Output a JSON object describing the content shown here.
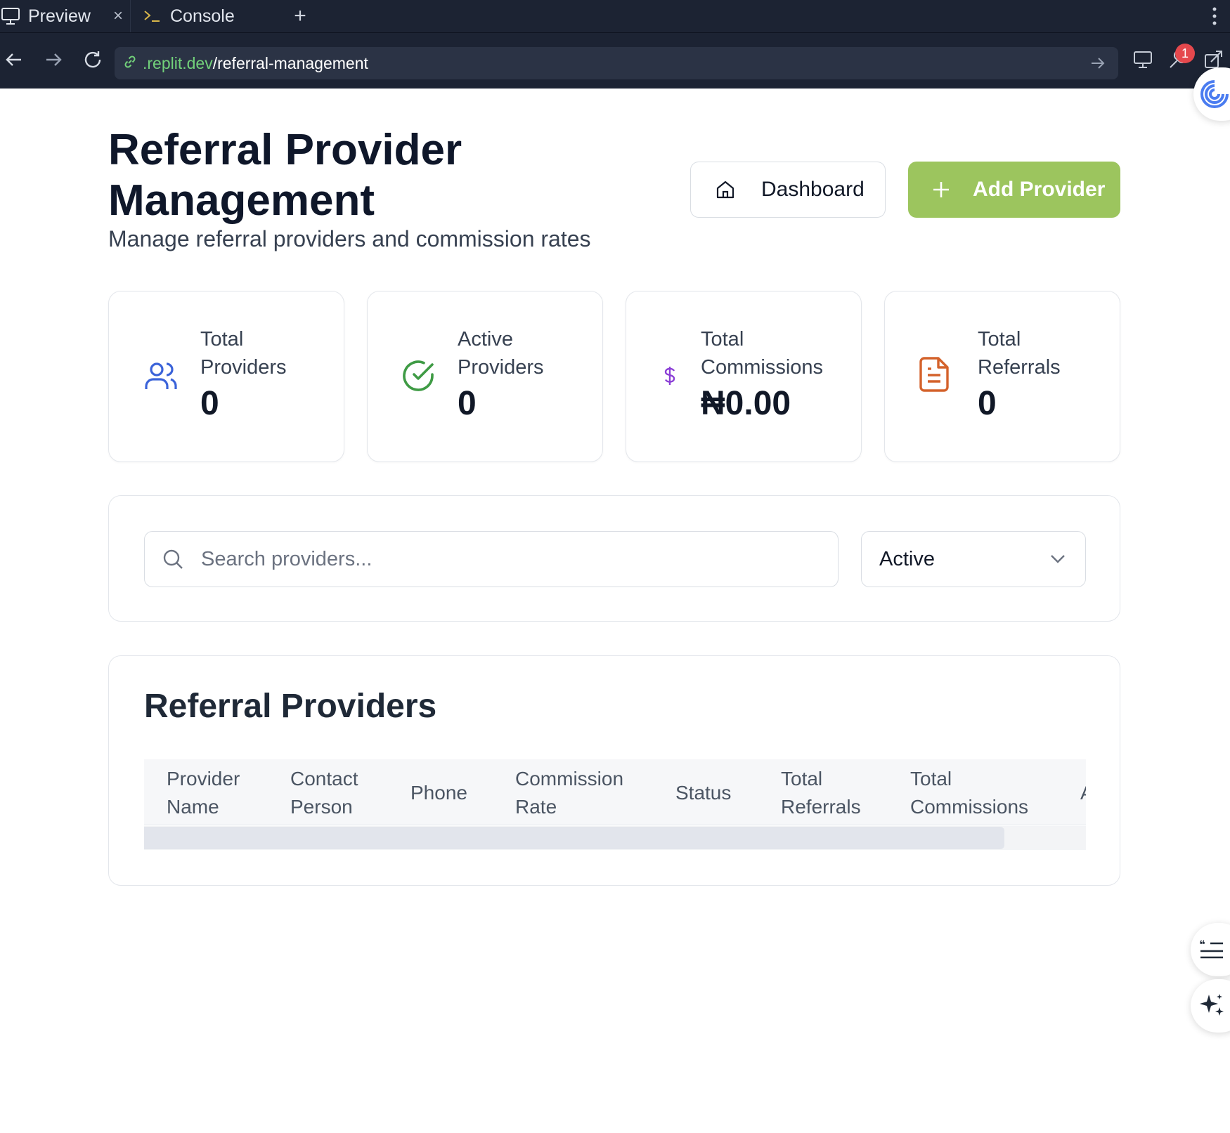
{
  "browser": {
    "tabs": [
      {
        "label": "Preview",
        "icon": "monitor-icon",
        "active": true
      },
      {
        "label": "Console",
        "icon": "terminal-icon",
        "active": false
      }
    ],
    "close_glyph": "×",
    "new_tab_glyph": "+",
    "url_host": ".replit.dev",
    "url_path": "/referral-management",
    "notification_count": "1"
  },
  "header": {
    "title": "Referral Provider Management",
    "subtitle": "Manage referral providers and commission rates",
    "dashboard_label": "Dashboard",
    "add_label": "Add Provider"
  },
  "stats": [
    {
      "label": "Total Providers",
      "value": "0",
      "icon": "users-icon",
      "color": "#3b63d9"
    },
    {
      "label": "Active Providers",
      "value": "0",
      "icon": "check-circle-icon",
      "color": "#3f9b45"
    },
    {
      "label": "Total Commissions",
      "value": "₦0.00",
      "icon": "dollar-icon",
      "color": "#8b3fd6"
    },
    {
      "label": "Total Referrals",
      "value": "0",
      "icon": "file-text-icon",
      "color": "#d4622b"
    }
  ],
  "filters": {
    "search_placeholder": "Search providers...",
    "status_value": "Active"
  },
  "table": {
    "title": "Referral Providers",
    "columns": [
      "Provider Name",
      "Contact Person",
      "Phone",
      "Commission Rate",
      "Status",
      "Total Referrals",
      "Total Commissions",
      "A"
    ]
  },
  "colors": {
    "accent_green": "#9cc55e",
    "chrome_bg": "#1c2333",
    "url_host_green": "#72d17a"
  }
}
